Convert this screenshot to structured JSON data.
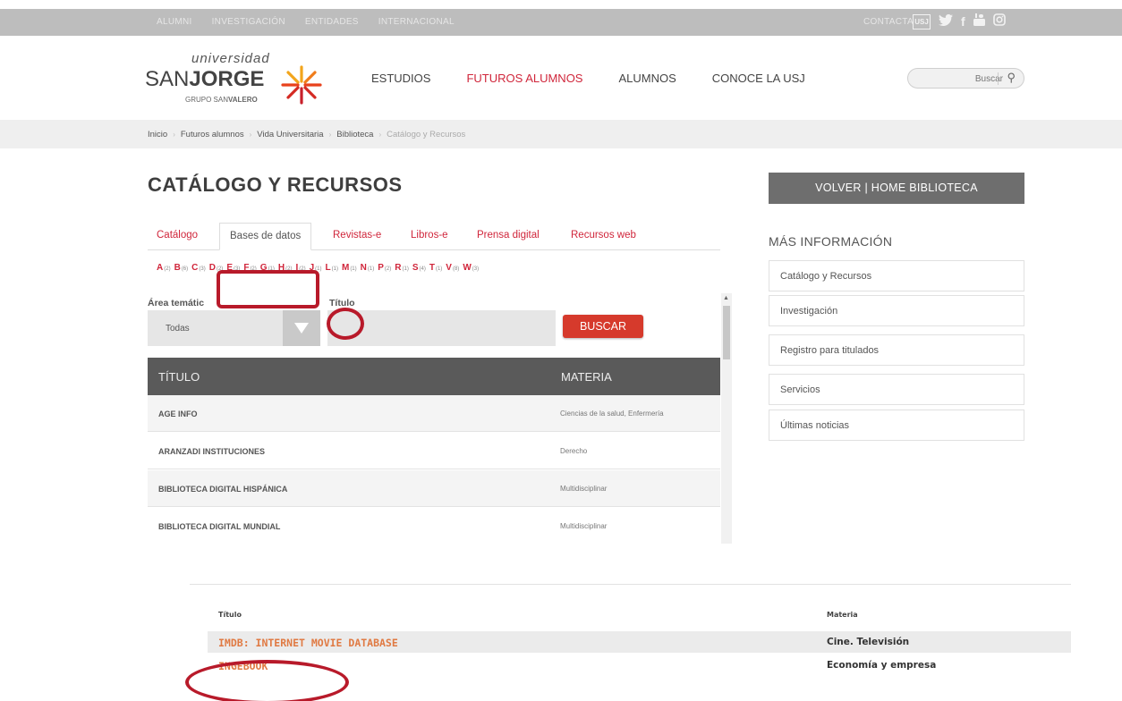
{
  "topbar": {
    "links": [
      "ALUMNI",
      "INVESTIGACIÓN",
      "ENTIDADES",
      "INTERNACIONAL"
    ],
    "contact": "CONTACTA",
    "social_icons": [
      "usj-icon",
      "twitter-icon",
      "facebook-icon",
      "youtube-icon",
      "instagram-icon"
    ]
  },
  "logo": {
    "line1": "universidad",
    "san": "SAN",
    "jorge": "JORGE",
    "grupo": "GRUPO SAN",
    "valero": "VALERO"
  },
  "nav": {
    "items": [
      "ESTUDIOS",
      "FUTUROS ALUMNOS",
      "ALUMNOS",
      "CONOCE LA USJ"
    ],
    "active": "FUTUROS ALUMNOS"
  },
  "search": {
    "placeholder": "Buscar"
  },
  "breadcrumb": [
    "Inicio",
    "Futuros alumnos",
    "Vida Universitaria",
    "Biblioteca",
    "Catálogo y Recursos"
  ],
  "page_title": "CATÁLOGO Y RECURSOS",
  "tabs": [
    "Catálogo",
    "Bases de datos",
    "Revistas-e",
    "Libros-e",
    "Prensa digital",
    "Recursos web"
  ],
  "active_tab": "Bases de datos",
  "letters": [
    {
      "l": "A",
      "n": "(2)"
    },
    {
      "l": "B",
      "n": "(6)"
    },
    {
      "l": "C",
      "n": "(3)"
    },
    {
      "l": "D",
      "n": "(2)"
    },
    {
      "l": "E",
      "n": "(3)"
    },
    {
      "l": "F",
      "n": "(2)"
    },
    {
      "l": "G",
      "n": "(1)"
    },
    {
      "l": "H",
      "n": "(2)"
    },
    {
      "l": "I",
      "n": "(2)"
    },
    {
      "l": "J",
      "n": "(1)"
    },
    {
      "l": "L",
      "n": "(1)"
    },
    {
      "l": "M",
      "n": "(1)"
    },
    {
      "l": "N",
      "n": "(1)"
    },
    {
      "l": "P",
      "n": "(2)"
    },
    {
      "l": "R",
      "n": "(1)"
    },
    {
      "l": "S",
      "n": "(4)"
    },
    {
      "l": "T",
      "n": "(1)"
    },
    {
      "l": "V",
      "n": "(8)"
    },
    {
      "l": "W",
      "n": "(3)"
    }
  ],
  "filters": {
    "area_label": "Área temátic",
    "area_value": "Todas",
    "title_label": "Título",
    "button": "BUSCAR"
  },
  "table": {
    "headers": [
      "TÍTULO",
      "MATERIA"
    ],
    "rows": [
      {
        "title": "AGE INFO",
        "subject": "Ciencias de la salud, Enfermería"
      },
      {
        "title": "ARANZADI INSTITUCIONES",
        "subject": "Derecho"
      },
      {
        "title": "BIBLIOTECA DIGITAL HISPÁNICA",
        "subject": "Multidisciplinar"
      },
      {
        "title": "BIBLIOTECA DIGITAL MUNDIAL",
        "subject": "Multidisciplinar"
      }
    ]
  },
  "sidebar": {
    "back_button": "VOLVER | HOME BIBLIOTECA",
    "heading": "MÁS INFORMACIÓN",
    "links": [
      "Catálogo y Recursos",
      "Investigación",
      "Registro para titulados",
      "Servicios",
      "Últimas noticias"
    ]
  },
  "second_table": {
    "headers": [
      "Título",
      "Materia"
    ],
    "rows": [
      {
        "title": "IMDB: INTERNET MOVIE DATABASE",
        "subject": "Cine.  Televisión"
      },
      {
        "title": "INGEBOOK",
        "subject": "Economía y empresa"
      }
    ]
  },
  "annotation_color": "#b81a2a"
}
